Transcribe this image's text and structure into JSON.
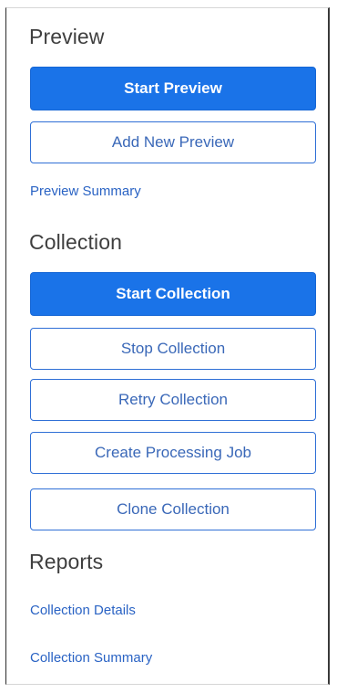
{
  "preview": {
    "heading": "Preview",
    "start_button": "Start Preview",
    "add_button": "Add New Preview",
    "summary_link": "Preview Summary"
  },
  "collection": {
    "heading": "Collection",
    "start_button": "Start Collection",
    "stop_button": "Stop Collection",
    "retry_button": "Retry Collection",
    "create_job_button": "Create Processing Job",
    "clone_button": "Clone Collection"
  },
  "reports": {
    "heading": "Reports",
    "details_link": "Collection Details",
    "summary_link": "Collection Summary"
  },
  "colors": {
    "primary": "#1a73e8",
    "link": "#2a63c4",
    "heading": "#3f3f3f"
  }
}
